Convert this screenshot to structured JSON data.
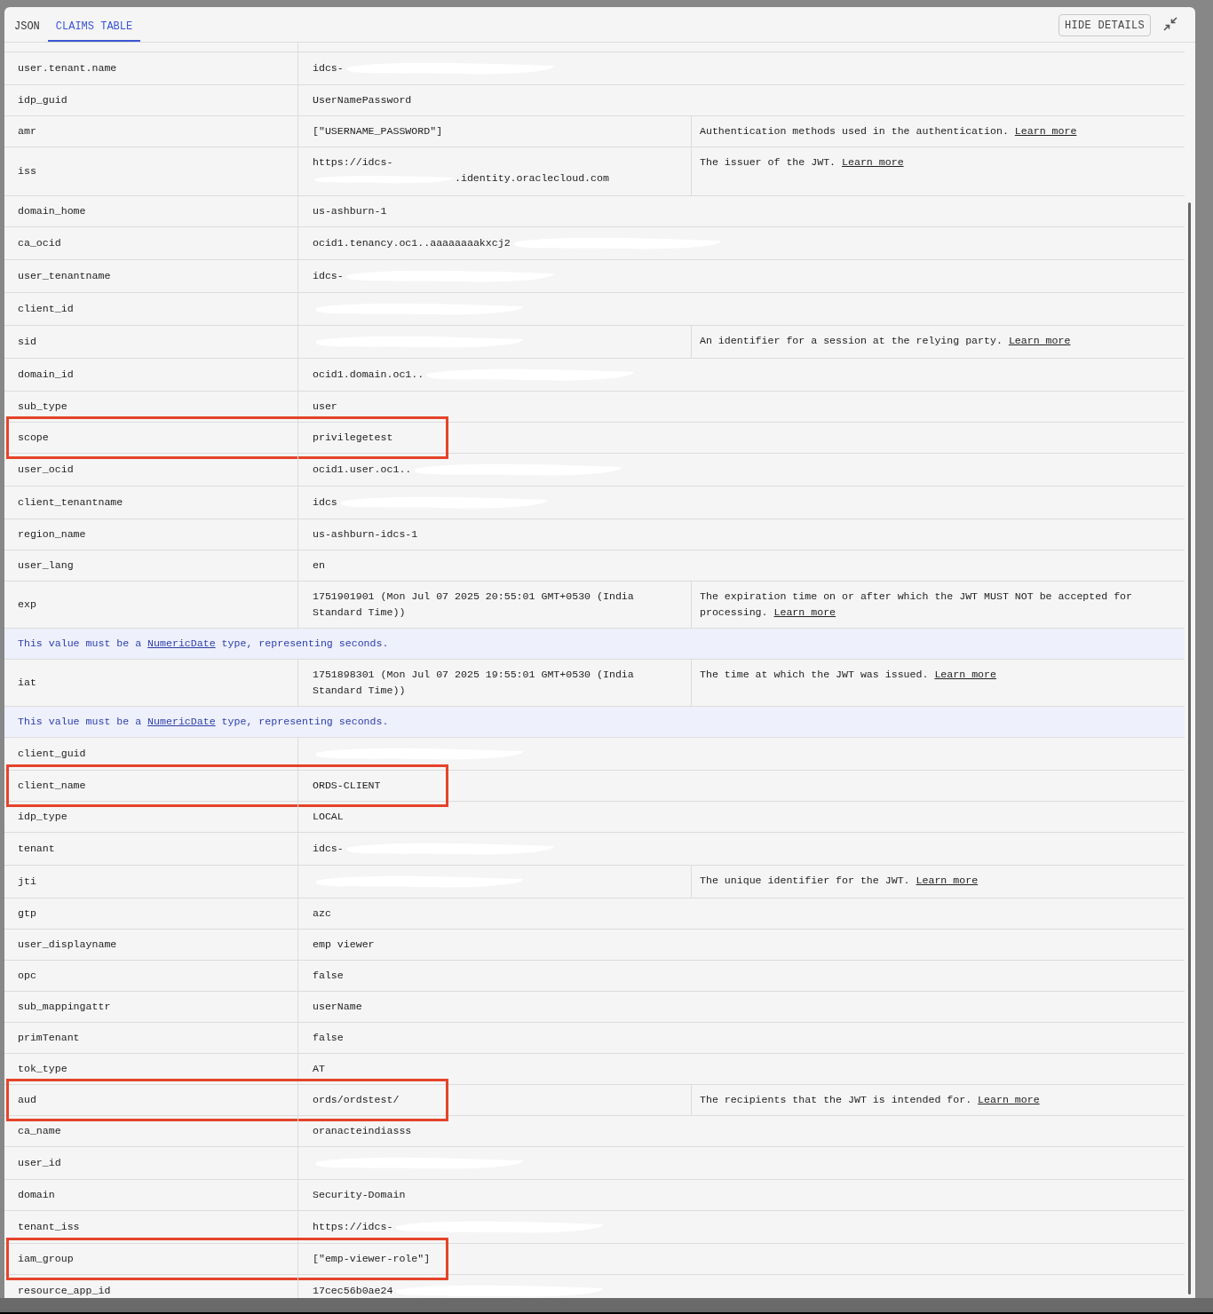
{
  "tabs": [
    {
      "label": "JSON",
      "selected": false
    },
    {
      "label": "CLAIMS TABLE",
      "selected": true
    }
  ],
  "toolbar": {
    "button": "HIDE DETAILS"
  },
  "rows": [
    {
      "kind": "claim",
      "name": "user.tenant.name",
      "value": "idcs-",
      "redacted": true
    },
    {
      "kind": "claim",
      "name": "idp_guid",
      "value": "UserNamePassword"
    },
    {
      "kind": "claim",
      "name": "amr",
      "value": "[\"USERNAME_PASSWORD\"]",
      "description": "Authentication methods used in the authentication.",
      "link": "Learn more"
    },
    {
      "kind": "claim",
      "name": "iss",
      "value": "https://idcs-",
      "redacted": true,
      "tail": ".identity.oraclecloud.com",
      "description": "The issuer of the JWT.",
      "link": "Learn more"
    },
    {
      "kind": "claim",
      "name": "domain_home",
      "value": "us-ashburn-1"
    },
    {
      "kind": "claim",
      "name": "ca_ocid",
      "value": "ocid1.tenancy.oc1..aaaaaaaakxcj2",
      "redacted": true
    },
    {
      "kind": "claim",
      "name": "user_tenantname",
      "value": "idcs-",
      "redacted": true
    },
    {
      "kind": "claim",
      "name": "client_id",
      "redacted": true
    },
    {
      "kind": "claim",
      "name": "sid",
      "redacted": true,
      "description": "An identifier for a session at the relying party.",
      "link": "Learn more"
    },
    {
      "kind": "claim",
      "name": "domain_id",
      "value": "ocid1.domain.oc1..",
      "redacted": true
    },
    {
      "kind": "claim",
      "name": "sub_type",
      "value": "user"
    },
    {
      "kind": "claim",
      "name": "scope",
      "value": "privilegetest",
      "highlighted": true
    },
    {
      "kind": "claim",
      "name": "user_ocid",
      "value": "ocid1.user.oc1..",
      "redacted": true
    },
    {
      "kind": "claim",
      "name": "client_tenantname",
      "value": "idcs",
      "redacted": true
    },
    {
      "kind": "claim",
      "name": "region_name",
      "value": "us-ashburn-idcs-1"
    },
    {
      "kind": "claim",
      "name": "user_lang",
      "value": "en"
    },
    {
      "kind": "claim",
      "name": "exp",
      "value": "1751901901 (Mon Jul 07 2025 20:55:01 GMT+0530 (India Standard Time))",
      "description": "The expiration time on or after which the JWT MUST NOT be accepted for processing.",
      "link": "Learn more"
    },
    {
      "kind": "note",
      "before": "This value must be a",
      "link": "NumericDate",
      "after": "type, representing seconds."
    },
    {
      "kind": "claim",
      "name": "iat",
      "value": "1751898301 (Mon Jul 07 2025 19:55:01 GMT+0530 (India Standard Time))",
      "description": "The time at which the JWT was issued.",
      "link": "Learn more"
    },
    {
      "kind": "note",
      "before": "This value must be a",
      "link": "NumericDate",
      "after": "type, representing seconds."
    },
    {
      "kind": "claim",
      "name": "client_guid",
      "redacted": true
    },
    {
      "kind": "claim",
      "name": "client_name",
      "value": "ORDS-CLIENT",
      "highlighted": true
    },
    {
      "kind": "claim",
      "name": "idp_type",
      "value": "LOCAL"
    },
    {
      "kind": "claim",
      "name": "tenant",
      "value": "idcs-",
      "redacted": true
    },
    {
      "kind": "claim",
      "name": "jti",
      "redacted": true,
      "description": "The unique identifier for the JWT.",
      "link": "Learn more"
    },
    {
      "kind": "claim",
      "name": "gtp",
      "value": "azc"
    },
    {
      "kind": "claim",
      "name": "user_displayname",
      "value": "emp viewer"
    },
    {
      "kind": "claim",
      "name": "opc",
      "value": "false"
    },
    {
      "kind": "claim",
      "name": "sub_mappingattr",
      "value": "userName"
    },
    {
      "kind": "claim",
      "name": "primTenant",
      "value": "false"
    },
    {
      "kind": "claim",
      "name": "tok_type",
      "value": "AT"
    },
    {
      "kind": "claim",
      "name": "aud",
      "value": "ords/ordstest/",
      "highlighted": true,
      "description": "The recipients that the JWT is intended for.",
      "link": "Learn more"
    },
    {
      "kind": "claim",
      "name": "ca_name",
      "value": "oranacteindiasss"
    },
    {
      "kind": "claim",
      "name": "user_id",
      "redacted": true
    },
    {
      "kind": "claim",
      "name": "domain",
      "value": "Security-Domain"
    },
    {
      "kind": "claim",
      "name": "tenant_iss",
      "value": "https://idcs-",
      "redacted": true
    },
    {
      "kind": "claim",
      "name": "iam_group",
      "value": "[\"emp-viewer-role\"]",
      "highlighted": true
    },
    {
      "kind": "claim",
      "name": "resource_app_id",
      "value": "17cec56b0ae24",
      "redacted": true
    }
  ]
}
